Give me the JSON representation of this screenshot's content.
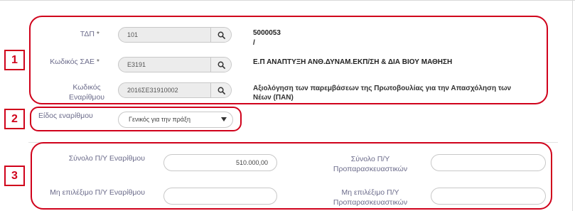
{
  "section_top": {
    "tdp": {
      "label": "ΤΔΠ",
      "required_mark": "*",
      "value": "101",
      "result_code": "5000053",
      "result_sub": "/"
    },
    "sae": {
      "label": "Κωδικός ΣΑΕ",
      "required_mark": "*",
      "value": "Ε3191",
      "result": "Ε.Π ΑΝΑΠΤΥΞΗ ΑΝΘ.ΔΥΝΑΜ.ΕΚΠ/ΣΗ & ΔΙΑ ΒΙΟΥ ΜΑΘΗΣΗ"
    },
    "enarithmos": {
      "label_line1": "Κωδικός",
      "label_line2": "Εναρίθμου",
      "value": "2016ΣΕ31910002",
      "result_line1": "Αξιολόγηση των παρεμβάσεων της Πρωτοβουλίας για την Απασχόληση των",
      "result_line2": "Νέων (ΠΑΝ)"
    }
  },
  "section_type": {
    "label": "Είδος εναρίθμου",
    "selected": "Γενικός για την πράξη"
  },
  "section_budget": {
    "total_enarithmou": {
      "label": "Σύνολο Π/Υ Εναρίθμου",
      "value": "510.000,00"
    },
    "total_prep": {
      "label_line1": "Σύνολο Π/Υ",
      "label_line2": "Προπαρασκευαστικών",
      "value": ""
    },
    "non_eligible_enarithmou": {
      "label": "Μη επιλέξιμο Π/Υ Εναρίθμου",
      "value": ""
    },
    "non_eligible_prep": {
      "label_line1": "Μη επιλέξιμο Π/Υ",
      "label_line2": "Προπαρασκευαστικών",
      "value": ""
    }
  },
  "annotations": {
    "badge1": "1",
    "badge2": "2",
    "badge3": "3",
    "highlight_color": "#d0021b"
  }
}
